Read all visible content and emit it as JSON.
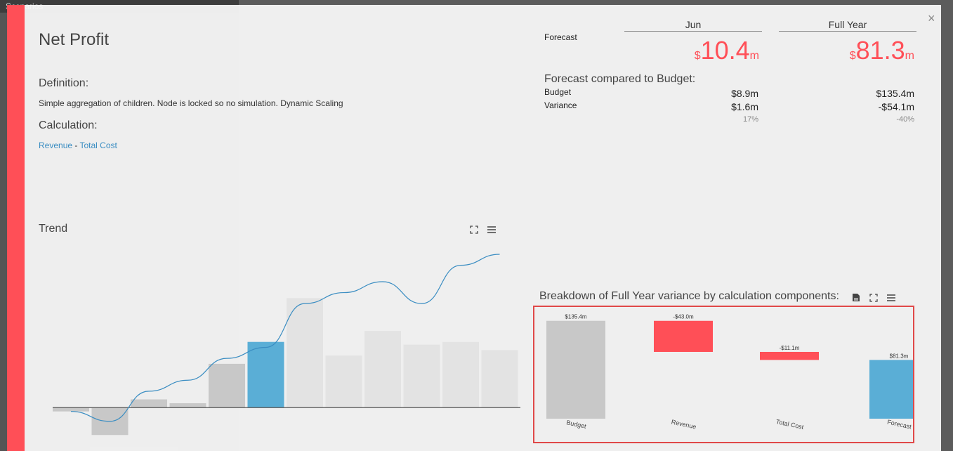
{
  "background": {
    "panel_title": "Scenarios"
  },
  "modal": {
    "title": "Net Profit",
    "close_label": "×",
    "definition": {
      "heading": "Definition:",
      "text": "Simple aggregation of children. Node is locked so no simulation. Dynamic Scaling"
    },
    "calculation": {
      "heading": "Calculation:",
      "term1": "Revenue",
      "operator": " - ",
      "term2": "Total Cost"
    },
    "trend": {
      "heading": "Trend",
      "expand_icon": "expand-icon",
      "menu_icon": "menu-icon"
    },
    "stats": {
      "forecast_label": "Forecast",
      "columns": [
        {
          "header": "Jun",
          "currency": "$",
          "value": "10.4",
          "unit": "m",
          "budget": "$8.9m",
          "variance": "$1.6m",
          "variance_pct": "17%"
        },
        {
          "header": "Full Year",
          "currency": "$",
          "value": "81.3",
          "unit": "m",
          "budget": "$135.4m",
          "variance": "-$54.1m",
          "variance_pct": "-40%"
        }
      ],
      "compare_heading": "Forecast compared to Budget:",
      "budget_label": "Budget",
      "variance_label": "Variance"
    },
    "breakdown": {
      "heading": "Breakdown of Full Year variance by calculation components:"
    }
  },
  "colors": {
    "accent": "#ff4f57",
    "highlight_bar": "#5aaed6",
    "bar_grey": "#c8c8c8",
    "bar_light": "#e3e3e3",
    "line": "#3a8dc2"
  },
  "chart_data": [
    {
      "type": "bar",
      "title": "Trend",
      "categories": [
        "",
        "",
        "",
        "",
        "",
        "",
        "",
        "",
        "",
        "",
        "",
        ""
      ],
      "values": [
        -0.7,
        -5.0,
        1.5,
        0.8,
        8.0,
        12.0,
        20.0,
        9.5,
        14.0,
        11.5,
        12.0,
        10.5
      ],
      "highlight_index": 5,
      "line_series": {
        "values": [
          -0.7,
          -2.5,
          3.0,
          5.0,
          9.0,
          11.0,
          19.0,
          21.0,
          23.0,
          19.0,
          26.0,
          28.0
        ]
      },
      "ylim": [
        -6,
        28
      ],
      "grid": false
    },
    {
      "type": "bar",
      "subtype": "waterfall",
      "categories": [
        "Budget",
        "Revenue",
        "Total Cost",
        "Forecast"
      ],
      "values": [
        135.4,
        -43.0,
        -11.1,
        81.3
      ],
      "labels": [
        "$135.4m",
        "-$43.0m",
        "-$11.1m",
        "$81.3m"
      ],
      "ylim": [
        0,
        140
      ],
      "grid": false
    }
  ]
}
